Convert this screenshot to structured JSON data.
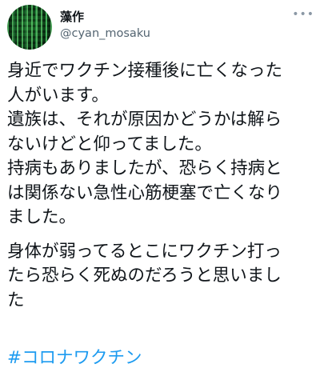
{
  "tweet": {
    "author_name": "藻作",
    "author_handle": "@cyan_mosaku",
    "more_icon": "more-horizontal-icon",
    "paragraphs": [
      {
        "lines": [
          "身近でワクチン接種後に亡くなった",
          "人がいます。",
          "遺族は、それが原因かどうかは解ら",
          "ないけどと仰ってました。",
          "持病もありましたが、恐らく持病と",
          "は関係ない急性心筋梗塞で亡くなり",
          "ました。"
        ]
      },
      {
        "lines": [
          "身体が弱ってるとこにワクチン打っ",
          "たら恐らく死ぬのだろうと思いまし",
          "た"
        ]
      }
    ],
    "hashtag": "#コロナワクチン"
  }
}
